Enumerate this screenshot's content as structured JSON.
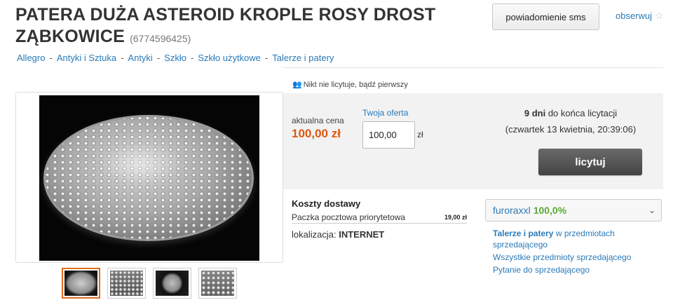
{
  "header": {
    "title": "PATERA DUŻA ASTEROID KROPLE ROSY DROST ZĄBKOWICE",
    "offer_id": "(6774596425)",
    "sms_button": "powiadomienie sms",
    "watch_link": "obserwuj",
    "watch_icon": "star-outline-icon"
  },
  "breadcrumb": [
    "Allegro",
    "Antyki i Sztuka",
    "Antyki",
    "Szkło",
    "Szkło użytkowe",
    "Talerze i patery"
  ],
  "breadcrumb_separator": "-",
  "bidders_note": "Nikt nie licytuje, bądź pierwszy",
  "auction": {
    "current_price_label": "aktualna cena",
    "current_price": "100,00 zł",
    "your_offer_label": "Twoja oferta",
    "your_offer_value": "100,00",
    "currency": "zł",
    "time_left_bold": "9 dni",
    "time_left_rest": " do końca licytacji",
    "end_date": "(czwartek 13 kwietnia, 20:39:06)",
    "bid_button": "licytuj"
  },
  "shipping": {
    "title": "Koszty dostawy",
    "method": "Paczka pocztowa priorytetowa",
    "cost": "19,00 zł",
    "location_label": "lokalizacja: ",
    "location_value": "INTERNET"
  },
  "seller": {
    "name": "furoraxxl",
    "score": "100,0%",
    "links": {
      "category_bold": "Talerze i patery",
      "category_rest": " w przedmiotach sprzedającego",
      "all_items": "Wszystkie przedmioty sprzedającego",
      "ask": "Pytanie do sprzedającego"
    }
  },
  "colors": {
    "link": "#2a7ab8",
    "price": "#e0560e",
    "seller_score": "#5ca83a",
    "thumb_active_border": "#e06a1b"
  }
}
